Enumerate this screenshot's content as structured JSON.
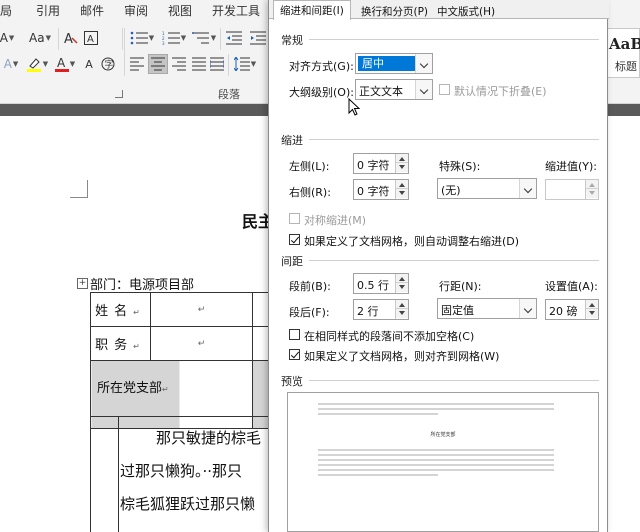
{
  "ribbon": {
    "menu": [
      "局",
      "引用",
      "邮件",
      "审阅",
      "视图",
      "开发工具"
    ],
    "font_size_label": "Aa",
    "group_label": "段落",
    "styles_sample": "AaBl",
    "styles_name": "标题"
  },
  "document": {
    "title": "民主",
    "department_line": "部门：电源项目部",
    "form": {
      "name_label": "姓名",
      "position_label": "职务",
      "branch_label": "所在党支部",
      "para_mark": "↵"
    },
    "body_lines": [
      "那只敏捷的棕毛",
      "过那只懒狗。··那只",
      "棕毛狐狸跃过那只懒"
    ]
  },
  "dialog": {
    "tabs": [
      "缩进和间距(I)",
      "换行和分页(P)",
      "中文版式(H)"
    ],
    "general": {
      "section": "常规",
      "alignment_label": "对齐方式(G):",
      "alignment_value": "居中",
      "outline_label": "大纲级别(O):",
      "outline_value": "正文文本",
      "collapsed_label": "默认情况下折叠(E)"
    },
    "indent": {
      "section": "缩进",
      "left_label": "左侧(L):",
      "left_value": "0 字符",
      "right_label": "右侧(R):",
      "right_value": "0 字符",
      "special_label": "特殊(S):",
      "special_value": "(无)",
      "indent_by_label": "缩进值(Y):",
      "indent_by_value": "",
      "mirror_label": "对称缩进(M)",
      "auto_adjust_label": "如果定义了文档网格，则自动调整右缩进(D)"
    },
    "spacing": {
      "section": "间距",
      "before_label": "段前(B):",
      "before_value": "0.5 行",
      "after_label": "段后(F):",
      "after_value": "2 行",
      "line_spacing_label": "行距(N):",
      "line_spacing_value": "固定值",
      "at_label": "设置值(A):",
      "at_value": "20 磅",
      "no_space_label": "在相同样式的段落间不添加空格(C)",
      "snap_grid_label": "如果定义了文档网格，则对齐到网格(W)"
    },
    "preview": {
      "section": "预览",
      "sample_text": "所在党支部"
    }
  },
  "colors": {
    "selection": "#0078d7",
    "ribbon_bg": "#f3f3f3",
    "highlight_yellow": "#ffff00",
    "font_red": "#e02020"
  }
}
